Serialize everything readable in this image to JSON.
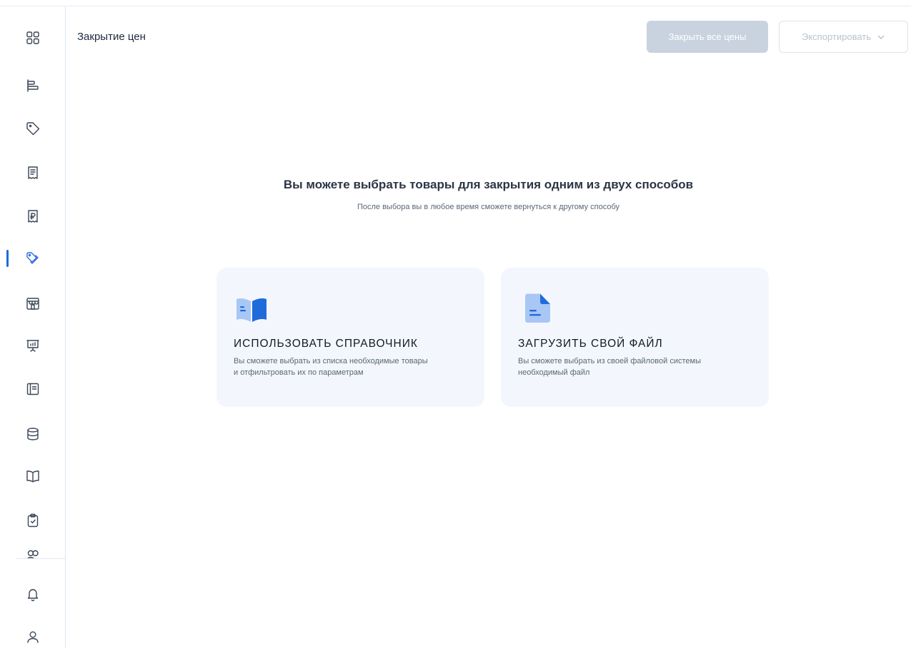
{
  "header": {
    "title": "Закрытие цен",
    "close_all_label": "Закрыть все цены",
    "export_label": "Экспортировать"
  },
  "main": {
    "headline": "Вы можете выбрать товары для закрытия одним из двух способов",
    "subline": "После выбора вы в любое время сможете вернуться к другому способу",
    "cards": [
      {
        "title": "ИСПОЛЬЗОВАТЬ СПРАВОЧНИК",
        "desc_line1": "Вы сможете выбрать из списка необходимые товары",
        "desc_line2": "и отфильтровать их по параметрам",
        "icon": "open-book-icon"
      },
      {
        "title": "ЗАГРУЗИТЬ СВОЙ ФАЙЛ",
        "desc_line1": "Вы сможете выбрать из своей файловой системы",
        "desc_line2": "необходимый файл",
        "icon": "file-upload-icon"
      }
    ]
  },
  "sidebar": {
    "active_index": 5,
    "items": [
      {
        "icon": "dashboard-grid-icon"
      },
      {
        "icon": "gantt-bars-icon"
      },
      {
        "icon": "price-tag-icon"
      },
      {
        "icon": "receipt-icon"
      },
      {
        "icon": "ruble-receipt-icon"
      },
      {
        "icon": "tags-discount-icon"
      },
      {
        "icon": "store-icon"
      },
      {
        "icon": "presentation-chart-icon"
      },
      {
        "icon": "catalog-book-icon"
      },
      {
        "icon": "database-icon"
      },
      {
        "icon": "open-book-icon"
      },
      {
        "icon": "clipboard-check-icon"
      },
      {
        "icon": "users-icon"
      },
      {
        "icon": "bell-icon"
      },
      {
        "icon": "user-icon"
      }
    ]
  },
  "colors": {
    "accent": "#1f6bdc",
    "card_background": "#f3f7fd",
    "disabled_button": "#c9d3e0"
  }
}
